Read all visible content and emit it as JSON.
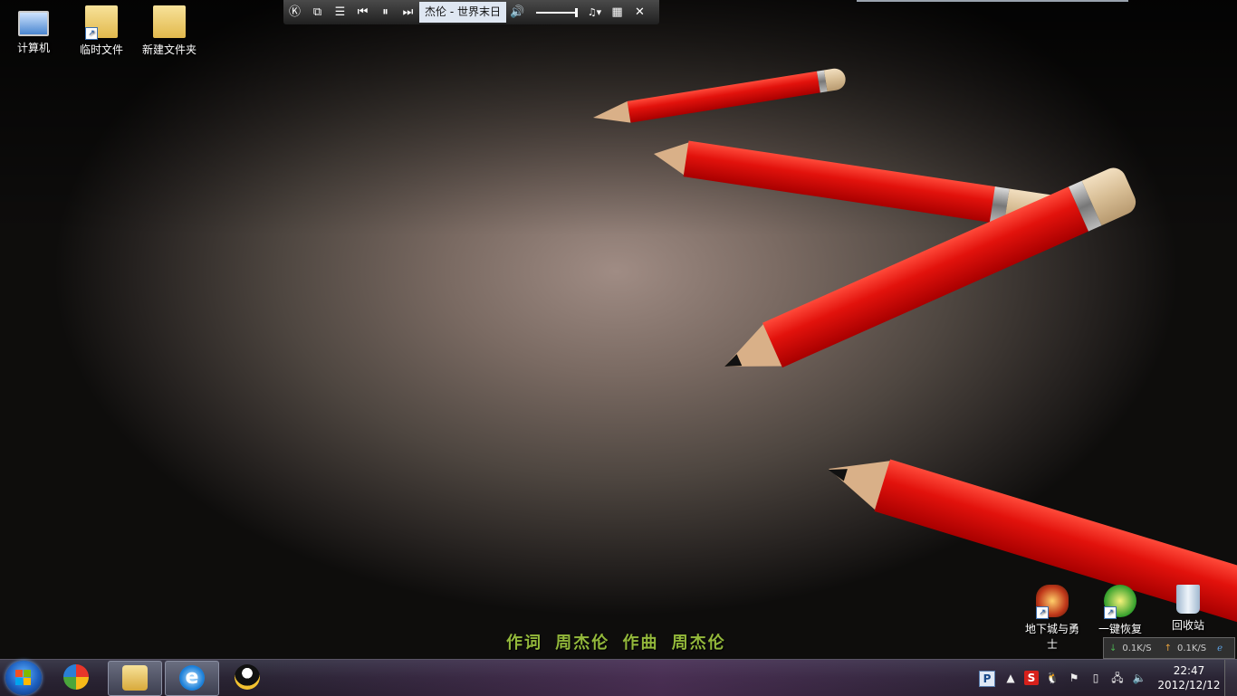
{
  "desktop": {
    "icons_left": [
      {
        "label": "计算机"
      },
      {
        "label": "临时文件"
      },
      {
        "label": "新建文件夹"
      }
    ],
    "icons_right": [
      {
        "label": "地下城与勇士"
      },
      {
        "label": "一键恢复"
      },
      {
        "label": "回收站"
      }
    ]
  },
  "player": {
    "logo": "Ⓚ",
    "track_title": "杰伦 - 世界末日",
    "volume_level": 0.9
  },
  "lyric": "作词 周杰伦 作曲 周杰伦",
  "netspeed": {
    "down": "0.1K/S",
    "up": "0.1K/S"
  },
  "taskbar": {
    "pinned": [
      {
        "name": "windows-live-icon"
      },
      {
        "name": "file-explorer-icon"
      },
      {
        "name": "internet-explorer-icon"
      },
      {
        "name": "qq-icon"
      }
    ],
    "tray": {
      "ime_label": "P",
      "sogou_label": "S"
    },
    "clock": {
      "time": "22:47",
      "date": "2012/12/12"
    }
  }
}
